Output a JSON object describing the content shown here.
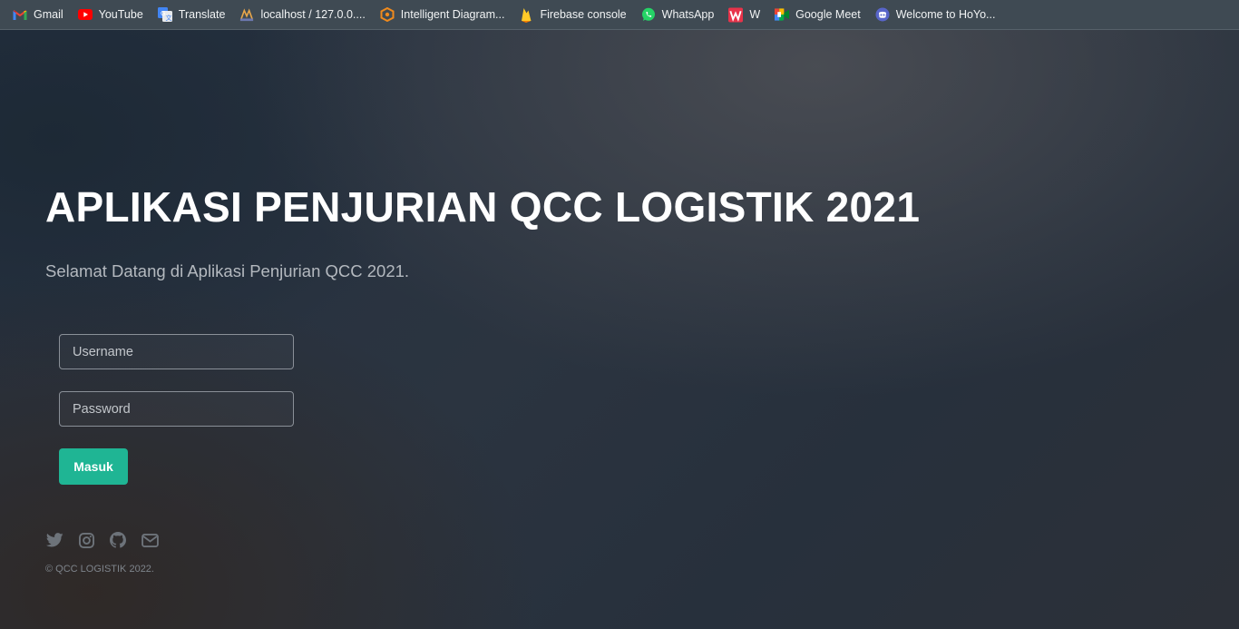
{
  "bookmarks": [
    {
      "label": "Gmail",
      "icon": "gmail-icon"
    },
    {
      "label": "YouTube",
      "icon": "youtube-icon"
    },
    {
      "label": "Translate",
      "icon": "translate-icon"
    },
    {
      "label": "localhost / 127.0.0....",
      "icon": "phpmyadmin-icon"
    },
    {
      "label": "Intelligent Diagram...",
      "icon": "diagram-icon"
    },
    {
      "label": "Firebase console",
      "icon": "firebase-icon"
    },
    {
      "label": "WhatsApp",
      "icon": "whatsapp-icon"
    },
    {
      "label": "W",
      "icon": "w-icon"
    },
    {
      "label": "Google Meet",
      "icon": "google-meet-icon"
    },
    {
      "label": "Welcome to HoYo...",
      "icon": "hoyo-icon"
    }
  ],
  "hero": {
    "title": "APLIKASI PENJURIAN QCC LOGISTIK 2021",
    "subtitle": "Selamat Datang di Aplikasi Penjurian QCC 2021."
  },
  "form": {
    "username_placeholder": "Username",
    "password_placeholder": "Password",
    "username_value": "",
    "password_value": "",
    "submit_label": "Masuk"
  },
  "social": [
    "twitter-icon",
    "instagram-icon",
    "github-icon",
    "email-icon"
  ],
  "footer": {
    "copyright": "© QCC LOGISTIK 2022."
  },
  "colors": {
    "accent": "#1fb594",
    "bookmark_bar": "#3f4a53"
  }
}
